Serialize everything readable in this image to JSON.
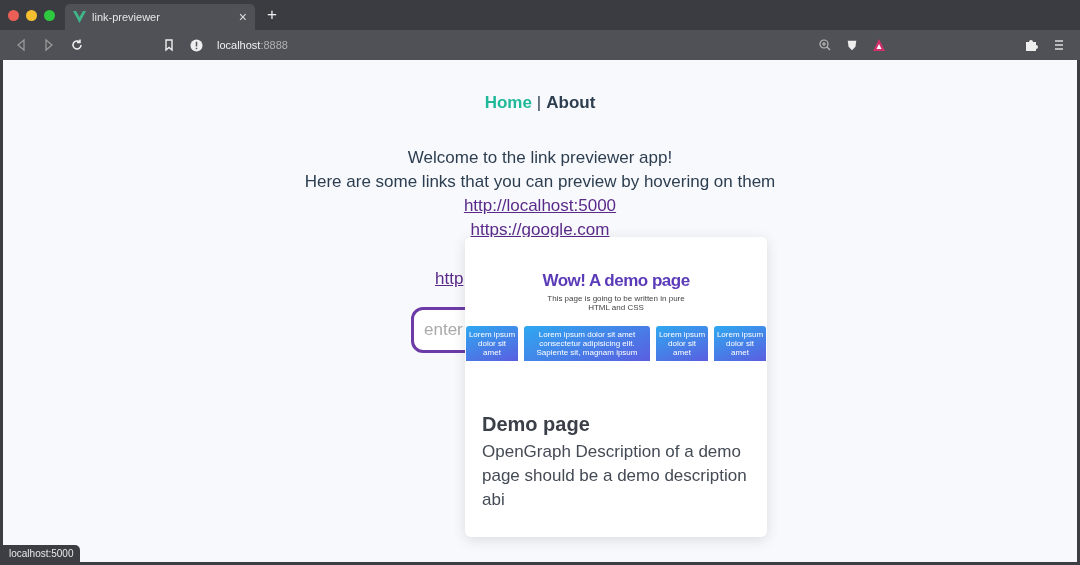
{
  "browser": {
    "tab": {
      "title": "link-previewer",
      "close": "×",
      "selected": true
    },
    "new_tab": "+",
    "address": {
      "host": "localhost",
      "port": ":8888"
    }
  },
  "nav": [
    {
      "label": "Home",
      "selected": true
    },
    {
      "label": "About",
      "selected": false
    }
  ],
  "nav_separator": "|",
  "intro": [
    "Welcome to the link previewer app!",
    "Here are some links that you can preview by hovering on them"
  ],
  "links": [
    "http://localhost:5000",
    "https://google.com",
    "http"
  ],
  "input": {
    "placeholder": "enter"
  },
  "preview": {
    "shot": {
      "heading": "Wow! A demo page",
      "subtitle": "This page is going to be written in pure HTML and CSS",
      "cards": [
        "Lorem ipsum dolor sit amet",
        "Lorem ipsum dolor sit amet consectetur adipisicing elit. Sapiente sit, magnam ipsum",
        "Lorem ipsum dolor sit amet",
        "Lorem ipsum dolor sit amet"
      ]
    },
    "title": "Demo page",
    "description": "OpenGraph Description of a demo page should be a demo description abi"
  },
  "status_bar": "localhost:5000"
}
